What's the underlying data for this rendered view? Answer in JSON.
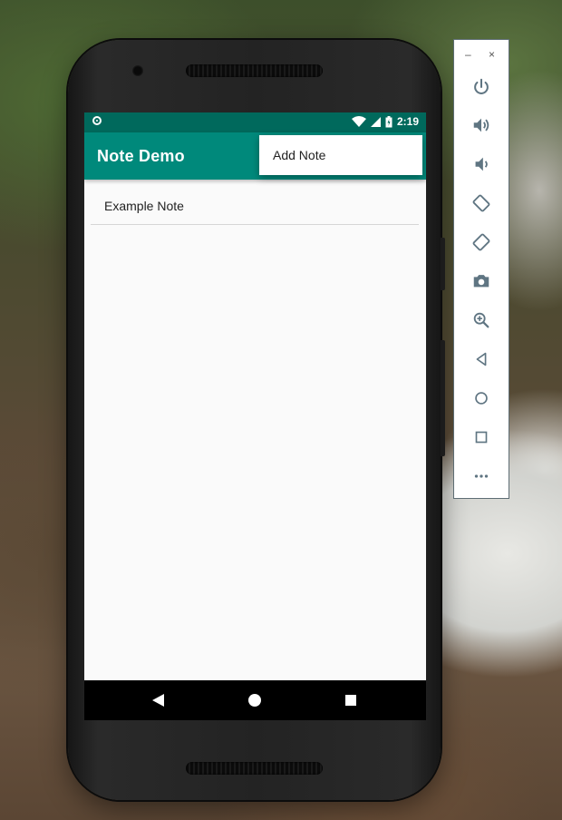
{
  "statusbar": {
    "time": "2:19"
  },
  "appbar": {
    "title": "Note Demo"
  },
  "menu": {
    "items": [
      "Add Note"
    ]
  },
  "notes": [
    "Example Note"
  ],
  "emulator": {
    "minimize_label": "–",
    "close_label": "×"
  },
  "colors": {
    "primary": "#00897b",
    "primary_dark": "#00695c",
    "accent_icon": "#5f7582"
  }
}
